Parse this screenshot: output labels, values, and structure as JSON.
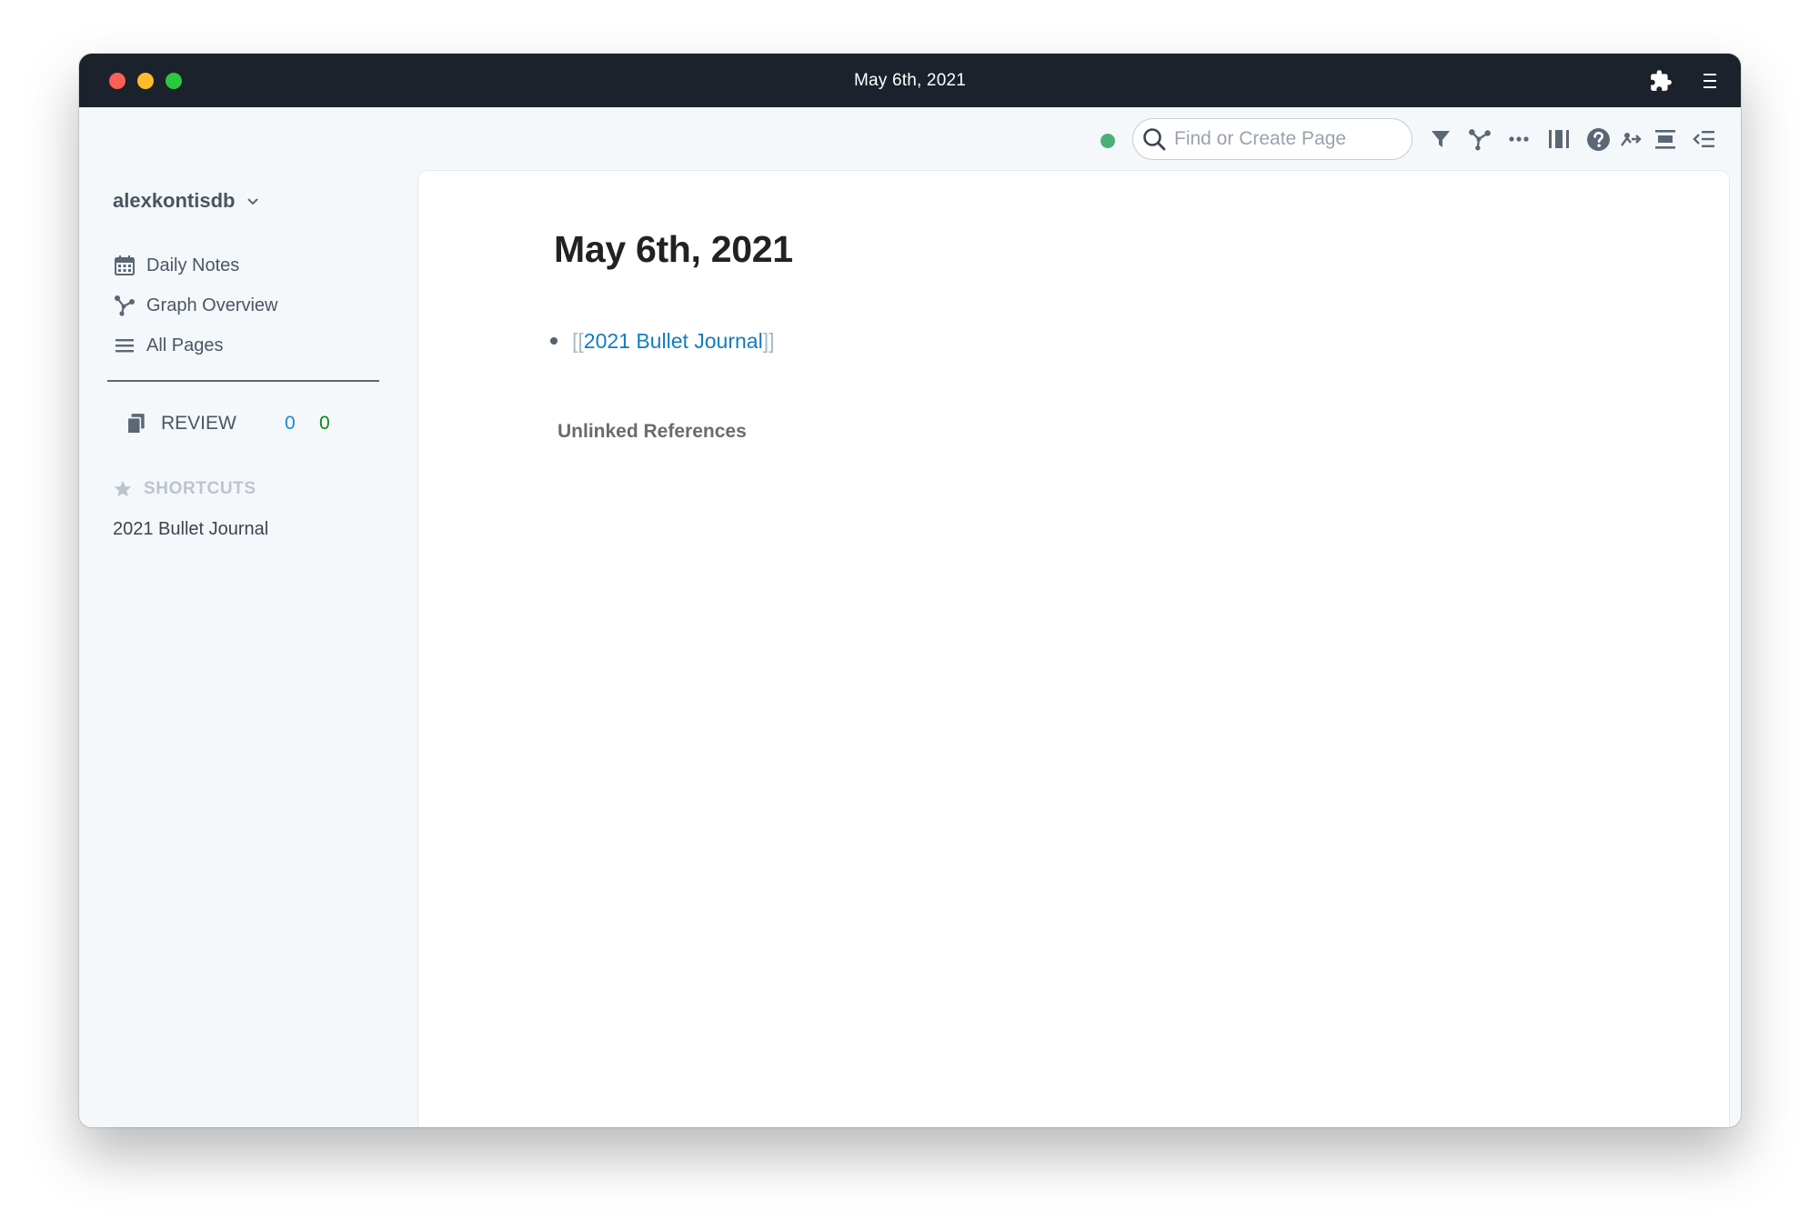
{
  "window": {
    "title": "May 6th, 2021"
  },
  "sidebar": {
    "graph_name": "alexkontisdb",
    "nav": [
      {
        "label": "Daily Notes",
        "icon": "calendar-icon"
      },
      {
        "label": "Graph Overview",
        "icon": "graph-icon"
      },
      {
        "label": "All Pages",
        "icon": "list-icon"
      }
    ],
    "review": {
      "label": "REVIEW",
      "count_due": "0",
      "count_new": "0",
      "count_due_color": "#1a87d8",
      "count_new_color": "#12851a"
    },
    "shortcuts": {
      "header": "SHORTCUTS",
      "items": [
        "2021 Bullet Journal"
      ]
    }
  },
  "topbar": {
    "status_color": "#4caf78",
    "search": {
      "placeholder": "Find or Create Page",
      "value": ""
    },
    "icons": [
      "filter-icon",
      "graph-icon",
      "more-icon",
      "columns-icon",
      "help-icon",
      "template-icon",
      "align-icon",
      "sidebar-toggle-icon"
    ]
  },
  "page": {
    "title": "May 6th, 2021",
    "blocks": [
      {
        "bracket_open": "[[",
        "link": "2021 Bullet Journal",
        "bracket_close": "]]"
      }
    ],
    "unlinked_references_label": "Unlinked References"
  },
  "colors": {
    "titlebar": "#1b222b",
    "sidebar_bg": "#f5f8fa",
    "link": "#137cbd"
  }
}
